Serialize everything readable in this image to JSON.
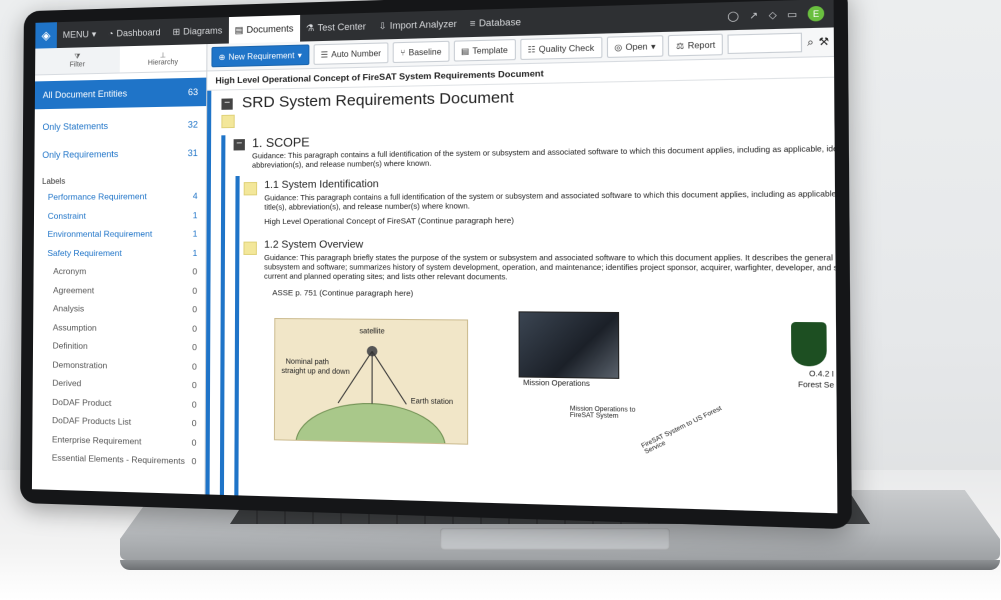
{
  "topbar": {
    "menu": "MENU",
    "nav": [
      "Dashboard",
      "Diagrams",
      "Documents",
      "Test Center",
      "Import Analyzer",
      "Database"
    ],
    "active_nav": "Documents",
    "avatar_initial": "E"
  },
  "sidebar": {
    "tabs": [
      "Filter",
      "Hierarchy"
    ],
    "entities": [
      {
        "label": "All Document Entities",
        "count": "63"
      },
      {
        "label": "Only Statements",
        "count": "32"
      },
      {
        "label": "Only Requirements",
        "count": "31"
      }
    ],
    "labels_heading": "Labels",
    "labels": [
      {
        "label": "Performance Requirement",
        "count": "4",
        "color": "blue"
      },
      {
        "label": "Constraint",
        "count": "1",
        "color": "blue"
      },
      {
        "label": "Environmental Requirement",
        "count": "1",
        "color": "blue"
      },
      {
        "label": "Safety Requirement",
        "count": "1",
        "color": "blue"
      },
      {
        "label": "Acronym",
        "count": "0",
        "color": "grey"
      },
      {
        "label": "Agreement",
        "count": "0",
        "color": "grey"
      },
      {
        "label": "Analysis",
        "count": "0",
        "color": "grey"
      },
      {
        "label": "Assumption",
        "count": "0",
        "color": "grey"
      },
      {
        "label": "Definition",
        "count": "0",
        "color": "grey"
      },
      {
        "label": "Demonstration",
        "count": "0",
        "color": "grey"
      },
      {
        "label": "Derived",
        "count": "0",
        "color": "grey"
      },
      {
        "label": "DoDAF Product",
        "count": "0",
        "color": "grey"
      },
      {
        "label": "DoDAF Products List",
        "count": "0",
        "color": "grey"
      },
      {
        "label": "Enterprise Requirement",
        "count": "0",
        "color": "grey"
      },
      {
        "label": "Essential Elements - Requirements",
        "count": "0",
        "color": "grey"
      }
    ]
  },
  "toolbar": {
    "new_requirement": "New Requirement",
    "auto_number": "Auto Number",
    "baseline": "Baseline",
    "template": "Template",
    "quality_check": "Quality Check",
    "open": "Open",
    "report": "Report"
  },
  "document": {
    "title": "High Level Operational Concept of FireSAT System Requirements Document",
    "root_heading": "SRD System Requirements Document",
    "scope_heading": "1. SCOPE",
    "scope_guidance": [
      "Guidance: This paragraph contains a full identification of the system or subsystem and associated software to which this document applies, including as applicable, identificatio",
      "abbreviation(s), and release number(s) where known."
    ],
    "sysid_heading": "1.1 System Identification",
    "sysid_guidance": [
      "Guidance: This paragraph contains a full identification of the system or subsystem and associated software to which this document applies, including as applicable, identifica",
      "title(s), abbreviation(s), and release number(s) where known."
    ],
    "sysid_para": "High Level Operational Concept of FireSAT (Continue paragraph here)",
    "overview_heading": "1.2 System Overview",
    "overview_guidance": [
      "Guidance: This paragraph briefly states the purpose of the system or subsystem and associated software to which this document applies.  It describes the general nature of",
      "subsystem and software; summarizes history of system development, operation, and maintenance; identifies project sponsor, acquirer, warfighter, developer, and support ag",
      "current and planned operating sites; and lists other relevant documents."
    ],
    "overview_para": "ASSE p. 751 (Continue paragraph here)"
  },
  "figure": {
    "satellite": "satellite",
    "sketch_text": [
      "Nominal path",
      "straight up and down"
    ],
    "earth_station": "Earth station",
    "mission_operations": "Mission Operations",
    "link1": "Mission Operations to FireSAT System",
    "link2": "FireSAT System to US Forest Service",
    "badge_text": "O.4.2 I",
    "forest": "Forest Se"
  }
}
